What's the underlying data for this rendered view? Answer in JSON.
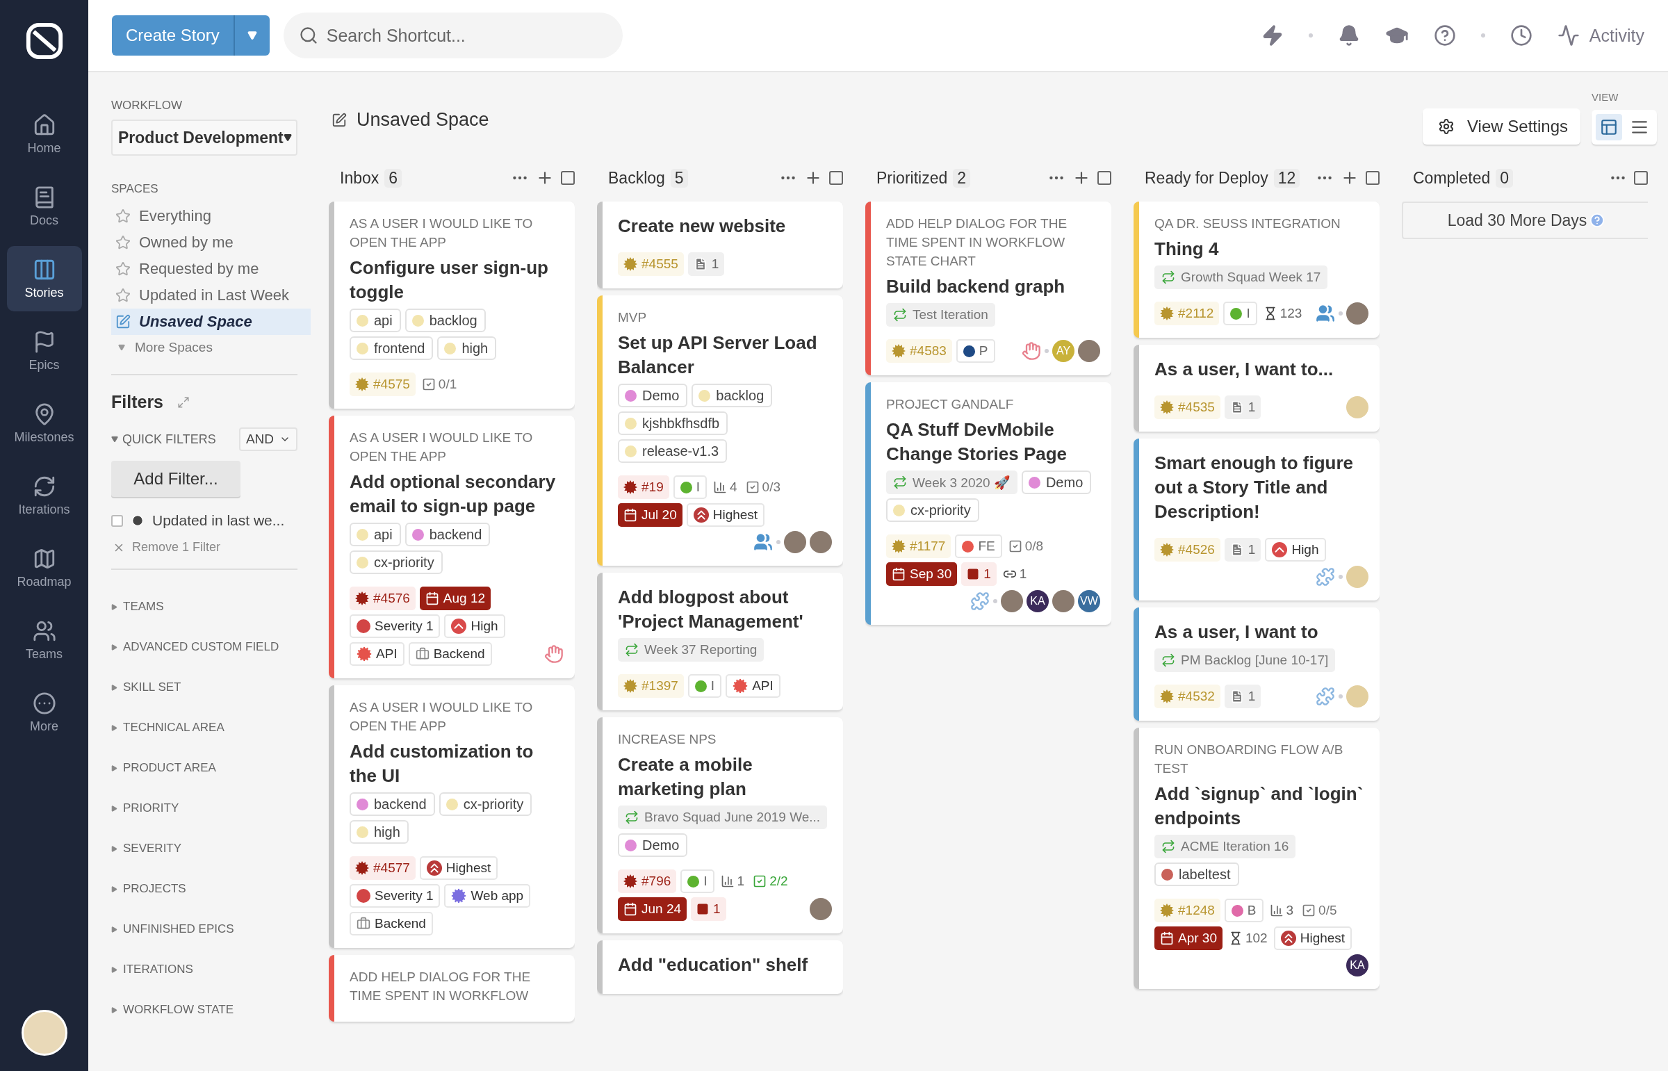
{
  "nav": {
    "items": [
      {
        "label": "Home",
        "selected": false
      },
      {
        "label": "Docs",
        "selected": false
      },
      {
        "label": "Stories",
        "selected": true
      },
      {
        "label": "Epics",
        "selected": false
      },
      {
        "label": "Milestones",
        "selected": false
      },
      {
        "label": "Iterations",
        "selected": false
      },
      {
        "label": "Roadmap",
        "selected": false
      },
      {
        "label": "Teams",
        "selected": false
      },
      {
        "label": "More",
        "selected": false
      }
    ]
  },
  "topbar": {
    "create_button": "Create Story",
    "search": {
      "placeholder": "Search Shortcut..."
    },
    "activity": "Activity"
  },
  "sidebar": {
    "workflow_label": "WORKFLOW",
    "workflow": "Product Development",
    "spaces_label": "SPACES",
    "spaces": [
      {
        "label": "Everything",
        "selected": false
      },
      {
        "label": "Owned by me",
        "selected": false
      },
      {
        "label": "Requested by me",
        "selected": false
      },
      {
        "label": "Updated in Last Week",
        "selected": false
      },
      {
        "label": "Unsaved Space",
        "selected": true
      }
    ],
    "more_spaces": "More Spaces",
    "filters_title": "Filters",
    "quick_filters": "QUICK FILTERS",
    "operator": "AND",
    "add_filter": "Add Filter...",
    "active_filter": {
      "label": "Updated in last we...",
      "checked": false
    },
    "remove_filter": "Remove 1 Filter",
    "sections": [
      {
        "label": "TEAMS",
        "expanded": false
      },
      {
        "label": "ADVANCED CUSTOM FIELD",
        "expanded": false
      },
      {
        "label": "SKILL SET",
        "expanded": false
      },
      {
        "label": "TECHNICAL AREA",
        "expanded": false
      },
      {
        "label": "PRODUCT AREA",
        "expanded": false
      },
      {
        "label": "PRIORITY",
        "expanded": false
      },
      {
        "label": "SEVERITY",
        "expanded": false
      },
      {
        "label": "PROJECTS",
        "expanded": false
      },
      {
        "label": "UNFINISHED EPICS",
        "expanded": false
      },
      {
        "label": "ITERATIONS",
        "expanded": false
      },
      {
        "label": "WORKFLOW STATE",
        "expanded": false
      }
    ]
  },
  "board": {
    "title": "Unsaved Space",
    "view_label": "VIEW",
    "view_settings": "View Settings",
    "views": [
      {
        "kind": "board",
        "selected": true
      },
      {
        "kind": "list",
        "selected": false
      }
    ],
    "columns": [
      {
        "name": "Inbox",
        "count": "6",
        "can_add": true,
        "checked": false,
        "cards": [
          {
            "color": "#c4c4c4",
            "epic": "AS A USER I WOULD LIKE TO OPEN THE APP",
            "title": "Configure user sign-up toggle",
            "labels": [
              {
                "text": "api",
                "color": "#f3e5ae"
              },
              {
                "text": "backlog",
                "color": "#f3e5ae"
              },
              {
                "text": "frontend",
                "color": "#f3e5ae"
              },
              {
                "text": "high",
                "color": "#f3e5ae"
              }
            ],
            "badges": [
              {
                "kind": "id",
                "text": "#4575",
                "color": "#b8952f"
              },
              {
                "kind": "tasks",
                "text": "0/1",
                "done": false
              }
            ]
          },
          {
            "color": "#e8574d",
            "epic": "AS A USER I WOULD LIKE TO OPEN THE APP",
            "title": "Add optional secondary email to sign-up page",
            "labels": [
              {
                "text": "api",
                "color": "#f3e5ae"
              },
              {
                "text": "backend",
                "color": "#e08ad6"
              },
              {
                "text": "cx-priority",
                "color": "#f3e5ae"
              }
            ],
            "badges": [
              {
                "kind": "id",
                "text": "#4576",
                "color": "#9b1f14"
              },
              {
                "kind": "date",
                "text": "Aug 12"
              },
              {
                "kind": "severity",
                "text": "Severity 1"
              },
              {
                "kind": "high",
                "text": "High"
              },
              {
                "kind": "technical",
                "text": "API",
                "color": "#e5534b"
              },
              {
                "kind": "product",
                "text": "Backend"
              },
              {
                "kind": "trail",
                "items": [
                  {
                    "kind": "hand"
                  }
                ]
              }
            ]
          },
          {
            "color": "#c4c4c4",
            "epic": "AS A USER I WOULD LIKE TO OPEN THE APP",
            "title": "Add customization to the UI",
            "labels": [
              {
                "text": "backend",
                "color": "#e08ad6"
              },
              {
                "text": "cx-priority",
                "color": "#f3e5ae"
              },
              {
                "text": "high",
                "color": "#f3e5ae"
              }
            ],
            "badges": [
              {
                "kind": "id",
                "text": "#4577",
                "color": "#9b1f14"
              },
              {
                "kind": "highest",
                "text": "Highest"
              },
              {
                "kind": "severity",
                "text": "Severity 1"
              },
              {
                "kind": "technical",
                "text": "Web app",
                "color": "#7b6fe0"
              },
              {
                "kind": "product",
                "text": "Backend"
              }
            ]
          },
          {
            "color": "#e8574d",
            "epic": "ADD HELP DIALOG FOR THE TIME SPENT IN WORKFLOW"
          }
        ]
      },
      {
        "name": "Backlog",
        "count": "5",
        "can_add": true,
        "checked": false,
        "cards": [
          {
            "color": "#c4c4c4",
            "title": "Create new website",
            "badges": [
              {
                "kind": "id",
                "text": "#4555",
                "color": "#b8952f"
              },
              {
                "kind": "docs",
                "text": "1"
              }
            ]
          },
          {
            "color": "#f5c94f",
            "epic": "MVP",
            "title": "Set up API Server Load Balancer",
            "labels": [
              {
                "text": "Demo",
                "color": "#e08ad6"
              },
              {
                "text": "backlog",
                "color": "#f3e5ae"
              },
              {
                "text": "kjshbkfhsdfb",
                "color": "#f3e5ae"
              },
              {
                "text": "release-v1.3",
                "color": "#f3e5ae"
              }
            ],
            "badges": [
              {
                "kind": "id",
                "text": "#19",
                "color": "#9b1f14"
              },
              {
                "kind": "team",
                "text": "I",
                "color": "#5db330"
              },
              {
                "kind": "estimate",
                "text": "4"
              },
              {
                "kind": "tasks",
                "text": "0/3",
                "done": false
              },
              {
                "kind": "date",
                "text": "Jul 20"
              },
              {
                "kind": "highest",
                "text": "Highest"
              },
              {
                "kind": "trail",
                "items": [
                  {
                    "kind": "people"
                  },
                  {
                    "kind": "sep"
                  },
                  {
                    "kind": "photo"
                  },
                  {
                    "kind": "photo"
                  }
                ]
              }
            ]
          },
          {
            "color": "#c4c4c4",
            "title": "Add blogpost about 'Project Management'",
            "iteration": "Week 37 Reporting",
            "badges": [
              {
                "kind": "id",
                "text": "#1397",
                "color": "#b8952f"
              },
              {
                "kind": "team",
                "text": "I",
                "color": "#5db330"
              },
              {
                "kind": "technical",
                "text": "API",
                "color": "#e5534b"
              }
            ]
          },
          {
            "color": "#c4c4c4",
            "epic": "INCREASE NPS",
            "title": "Create a mobile marketing plan",
            "iteration": "Bravo Squad June 2019 We...",
            "labels": [
              {
                "text": "Demo",
                "color": "#e08ad6"
              }
            ],
            "badges": [
              {
                "kind": "id",
                "text": "#796",
                "color": "#9b1f14"
              },
              {
                "kind": "team",
                "text": "I",
                "color": "#5db330"
              },
              {
                "kind": "estimate",
                "text": "1"
              },
              {
                "kind": "tasks",
                "text": "2/2",
                "done": true
              },
              {
                "kind": "date",
                "text": "Jun 24"
              },
              {
                "kind": "blocker",
                "text": "1"
              },
              {
                "kind": "trail",
                "items": [
                  {
                    "kind": "photo"
                  }
                ]
              }
            ]
          },
          {
            "color": "#c4c4c4",
            "title": "Add \"education\" shelf"
          }
        ]
      },
      {
        "name": "Prioritized",
        "count": "2",
        "can_add": true,
        "checked": false,
        "cards": [
          {
            "color": "#e8574d",
            "epic": "ADD HELP DIALOG FOR THE TIME SPENT IN WORKFLOW STATE CHART",
            "title": "Build backend graph",
            "iteration": "Test Iteration",
            "badges": [
              {
                "kind": "id",
                "text": "#4583",
                "color": "#b8952f"
              },
              {
                "kind": "team",
                "text": "P",
                "color": "#1f4a85"
              },
              {
                "kind": "trail",
                "items": [
                  {
                    "kind": "hand"
                  },
                  {
                    "kind": "sep"
                  },
                  {
                    "kind": "avatar",
                    "text": "AY",
                    "color": "#c9b23a"
                  },
                  {
                    "kind": "photo"
                  }
                ]
              }
            ]
          },
          {
            "color": "#5aa0d0",
            "epic": "PROJECT GANDALF",
            "title": "QA Stuff DevMobile Change Stories Page",
            "iteration": "Week 3 2020 🚀",
            "labels": [
              {
                "text": "Demo",
                "color": "#e08ad6"
              },
              {
                "text": "cx-priority",
                "color": "#f3e5ae"
              }
            ],
            "badges": [
              {
                "kind": "id",
                "text": "#1177",
                "color": "#b8952f"
              },
              {
                "kind": "team",
                "text": "FE",
                "color": "#e8574d"
              },
              {
                "kind": "tasks",
                "text": "0/8",
                "done": false
              },
              {
                "kind": "date",
                "text": "Sep 30"
              },
              {
                "kind": "blocker",
                "text": "1"
              },
              {
                "kind": "relation",
                "text": "1"
              },
              {
                "kind": "trail",
                "items": [
                  {
                    "kind": "puzzle"
                  },
                  {
                    "kind": "sep"
                  },
                  {
                    "kind": "photo"
                  },
                  {
                    "kind": "avatar",
                    "text": "KA",
                    "color": "#3b2a5a"
                  },
                  {
                    "kind": "photo"
                  },
                  {
                    "kind": "avatar",
                    "text": "VW",
                    "color": "#3a6e9e"
                  }
                ]
              }
            ]
          }
        ]
      },
      {
        "name": "Ready for Deploy",
        "count": "12",
        "can_add": true,
        "checked": false,
        "cards": [
          {
            "color": "#f5c94f",
            "epic": "QA DR. SEUSS INTEGRATION",
            "title": "Thing 4",
            "iteration": "Growth Squad Week 17",
            "badges": [
              {
                "kind": "id",
                "text": "#2112",
                "color": "#b8952f"
              },
              {
                "kind": "team",
                "text": "I",
                "color": "#5db330"
              },
              {
                "kind": "cycle",
                "text": "123"
              },
              {
                "kind": "trail",
                "items": [
                  {
                    "kind": "people"
                  },
                  {
                    "kind": "sep"
                  },
                  {
                    "kind": "photo"
                  }
                ]
              }
            ]
          },
          {
            "color": "#c4c4c4",
            "title": "As a user, I want to...",
            "badges": [
              {
                "kind": "id",
                "text": "#4535",
                "color": "#b8952f"
              },
              {
                "kind": "docs",
                "text": "1"
              },
              {
                "kind": "trail",
                "items": [
                  {
                    "kind": "mascot"
                  }
                ]
              }
            ]
          },
          {
            "color": "#5aa0d0",
            "title": "Smart enough to figure out a Story Title and Description!",
            "badges": [
              {
                "kind": "id",
                "text": "#4526",
                "color": "#b8952f"
              },
              {
                "kind": "docs",
                "text": "1"
              },
              {
                "kind": "high",
                "text": "High"
              },
              {
                "kind": "trail",
                "items": [
                  {
                    "kind": "puzzle"
                  },
                  {
                    "kind": "sep"
                  },
                  {
                    "kind": "mascot"
                  }
                ]
              }
            ]
          },
          {
            "color": "#5aa0d0",
            "title": "As a user, I want to",
            "iteration": "PM Backlog [June 10-17]",
            "badges": [
              {
                "kind": "id",
                "text": "#4532",
                "color": "#b8952f"
              },
              {
                "kind": "docs",
                "text": "1"
              },
              {
                "kind": "trail",
                "items": [
                  {
                    "kind": "puzzle"
                  },
                  {
                    "kind": "sep"
                  },
                  {
                    "kind": "mascot"
                  }
                ]
              }
            ]
          },
          {
            "color": "#c4c4c4",
            "epic": "RUN ONBOARDING FLOW A/B TEST",
            "title": "Add `signup` and `login` endpoints",
            "iteration": "ACME Iteration 16",
            "labels": [
              {
                "text": "labeltest",
                "color": "#c9625a"
              }
            ],
            "badges": [
              {
                "kind": "id",
                "text": "#1248",
                "color": "#b8952f"
              },
              {
                "kind": "team",
                "text": "B",
                "color": "#e06aa8"
              },
              {
                "kind": "estimate",
                "text": "3"
              },
              {
                "kind": "tasks",
                "text": "0/5",
                "done": false
              },
              {
                "kind": "date",
                "text": "Apr 30"
              },
              {
                "kind": "cycle",
                "text": "102"
              },
              {
                "kind": "highest",
                "text": "Highest"
              },
              {
                "kind": "trail",
                "items": [
                  {
                    "kind": "avatar",
                    "text": "KA",
                    "color": "#3b2a5a"
                  }
                ]
              }
            ]
          }
        ]
      },
      {
        "name": "Completed",
        "count": "0",
        "can_add": false,
        "checked": false,
        "load_more": "Load 30 More Days"
      }
    ]
  }
}
